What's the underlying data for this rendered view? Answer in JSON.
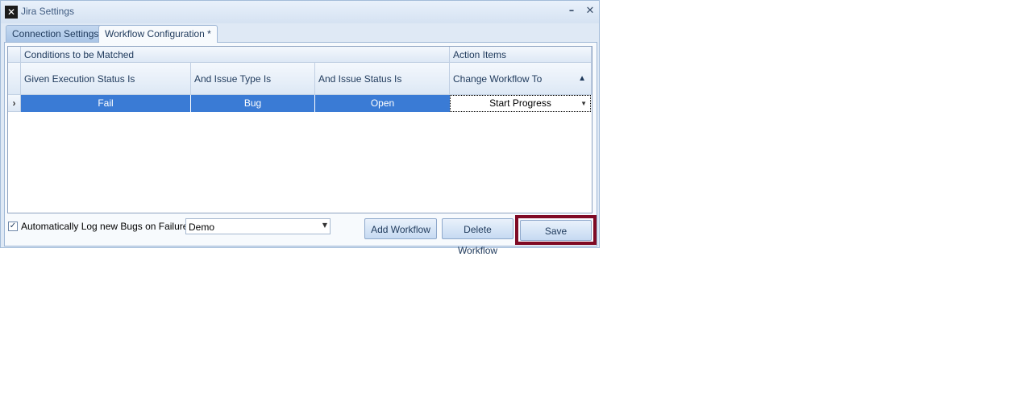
{
  "window": {
    "title": "Jira Settings",
    "minimize": "–",
    "close": "✕"
  },
  "tabs": [
    {
      "label": "Connection Settings",
      "active": false
    },
    {
      "label": "Workflow Configuration *",
      "active": true
    }
  ],
  "grid": {
    "group_headers": {
      "conditions": "Conditions to be Matched",
      "actions": "Action Items"
    },
    "columns": [
      "Given Execution Status Is",
      "And Issue Type Is",
      "And Issue Status Is",
      "Change Workflow To"
    ],
    "sort_indicator": "▲",
    "row_indicator": "›",
    "rows": [
      {
        "execution_status": "Fail",
        "issue_type": "Bug",
        "issue_status": "Open",
        "workflow": "Start Progress"
      }
    ]
  },
  "footer": {
    "auto_log_checked": true,
    "auto_log_label": "Automatically Log new Bugs on Failure",
    "project_value": "Demo",
    "add_workflow_label": "Add Workflow",
    "delete_workflow_label": "Delete Workflow",
    "save_label": "Save"
  },
  "colors": {
    "selection": "#3a7bd5",
    "highlight_border": "#7f0a24"
  }
}
